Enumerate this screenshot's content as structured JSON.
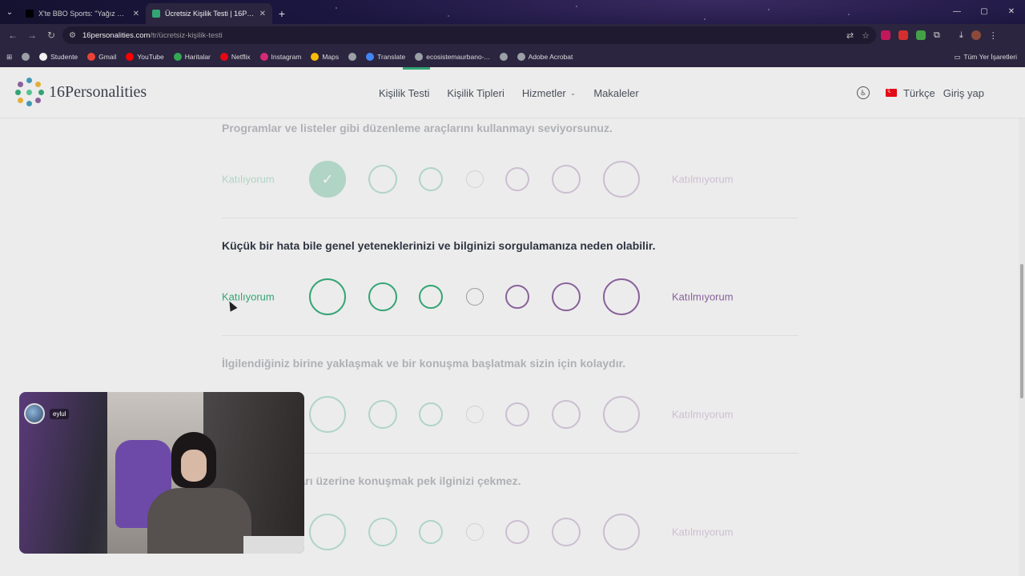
{
  "browser": {
    "tabs": [
      {
        "title": "X'te BBO Sports: \"Yağız Sabuncu",
        "active": false,
        "favicon_color": "#000000"
      },
      {
        "title": "Ücretsiz Kişilik Testi | 16Person",
        "active": true,
        "favicon_color": "#33a474"
      }
    ],
    "new_tab_symbol": "+",
    "window_controls": [
      "—",
      "▢",
      "✕"
    ],
    "url": {
      "host": "16personalities.com",
      "path": "/tr/ücretsiz-kişilik-testi"
    },
    "bookmarks": [
      {
        "label": "",
        "icon": "globe-icon",
        "color": "#9aa0a6"
      },
      {
        "label": "Studente",
        "icon": "studente-icon",
        "color": "#f1f1f1"
      },
      {
        "label": "Gmail",
        "icon": "gmail-icon",
        "color": "#ea4335"
      },
      {
        "label": "YouTube",
        "icon": "youtube-icon",
        "color": "#ff0000"
      },
      {
        "label": "Haritalar",
        "icon": "maps-pin-icon",
        "color": "#34a853"
      },
      {
        "label": "Netflix",
        "icon": "netflix-icon",
        "color": "#e50914"
      },
      {
        "label": "Instagram",
        "icon": "instagram-icon",
        "color": "#d62976"
      },
      {
        "label": "Maps",
        "icon": "maps-pin-icon",
        "color": "#fbbc05"
      },
      {
        "label": "",
        "icon": "globe-icon",
        "color": "#9aa0a6"
      },
      {
        "label": "Translate",
        "icon": "translate-icon",
        "color": "#4285f4"
      },
      {
        "label": "ecosistemaurbano-...",
        "icon": "globe-icon",
        "color": "#9aa0a6"
      },
      {
        "label": "",
        "icon": "globe-icon",
        "color": "#9aa0a6"
      },
      {
        "label": "Adobe Acrobat",
        "icon": "globe-icon",
        "color": "#9aa0a6"
      }
    ],
    "all_bookmarks": "Tüm Yer İşaretleri"
  },
  "header": {
    "logo_text": "16Personalities",
    "nav": [
      {
        "label": "Kişilik Testi",
        "active": true,
        "dropdown": false
      },
      {
        "label": "Kişilik Tipleri",
        "active": false,
        "dropdown": false
      },
      {
        "label": "Hizmetler",
        "active": false,
        "dropdown": true
      },
      {
        "label": "Makaleler",
        "active": false,
        "dropdown": false
      }
    ],
    "language": "Türkçe",
    "login": "Giriş yap"
  },
  "scale": {
    "agree_label": "Katılıyorum",
    "disagree_label": "Katılmıyorum",
    "agree_color": "#33a474",
    "disagree_color": "#88619a"
  },
  "questions": [
    {
      "text": "Programlar ve listeler gibi düzenleme araçlarını kullanmayı seviyorsunuz.",
      "faded": true,
      "selected": 0
    },
    {
      "text": "Küçük bir hata bile genel yeteneklerinizi ve bilginizi sorgulamanıza neden olabilir.",
      "faded": false,
      "selected": null
    },
    {
      "text": "İlgilendiğiniz birine yaklaşmak ve bir konuşma başlatmak sizin için kolaydır.",
      "faded": true,
      "selected": null
    },
    {
      "text": "n farklı yorumları üzerine konuşmak pek ilginizi çekmez.",
      "faded": true,
      "selected": null
    }
  ],
  "webcam": {
    "username": "eylul"
  }
}
